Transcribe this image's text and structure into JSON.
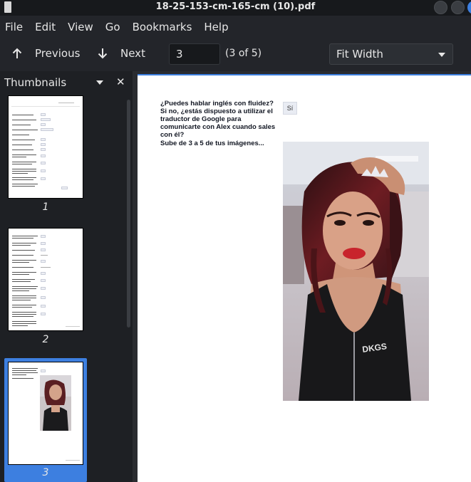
{
  "window": {
    "title": "18-25-153-cm-165-cm (10).pdf"
  },
  "menu": [
    "File",
    "Edit",
    "View",
    "Go",
    "Bookmarks",
    "Help"
  ],
  "toolbar": {
    "previous_label": "Previous",
    "next_label": "Next",
    "page_input": "3",
    "page_count": "(3 of 5)",
    "zoom": "Fit Width"
  },
  "sidebar": {
    "title": "Thumbnails",
    "pages": [
      "1",
      "2",
      "3"
    ],
    "selected_page": 3
  },
  "document": {
    "question_english": "¿Puedes hablar inglés con fluidez? Si no, ¿estás dispuesto a utilizar el traductor de Google para comunicarte con Alex cuando sales con él?",
    "answer_english": "Sí",
    "question_images": "Sube de 3 a 5 de tus imágenes..."
  },
  "colors": {
    "accent": "#3d7fe0",
    "background": "#1e2024",
    "page": "#ffffff"
  }
}
